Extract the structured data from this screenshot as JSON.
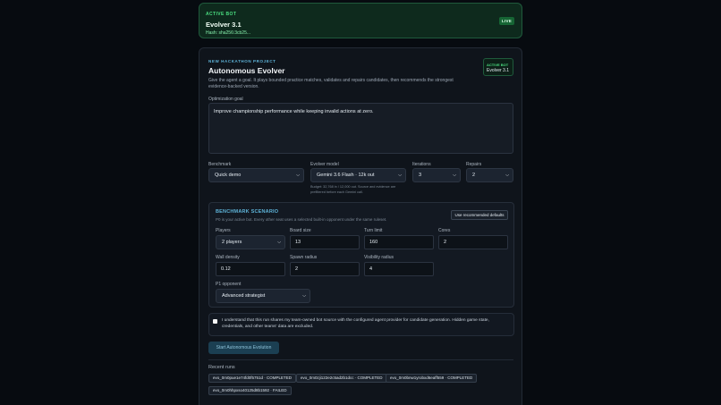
{
  "active_bot": {
    "label": "ACTIVE BOT",
    "name": "Evolver 3.1",
    "hash": "Hash: sha256:3cb25...",
    "status": "LIVE"
  },
  "project": {
    "eyebrow": "NEW HACKATHON PROJECT",
    "title": "Autonomous Evolver",
    "description": "Give the agent a goal. It plays bounded practice matches, validates and repairs candidates, then recommends the strongest evidence-backed version.",
    "badge_label": "ACTIVE BOT",
    "badge_value": "Evolver 3.1"
  },
  "goal": {
    "label": "Optimization goal",
    "value": "Improve championship performance while keeping invalid actions at zero."
  },
  "config": {
    "benchmark_label": "Benchmark",
    "benchmark_value": "Quick demo",
    "model_label": "Evolver model",
    "model_value": "Gemini 3.6 Flash · 12k out",
    "model_hint": "Budget: 32,768 in / 12,000 out. Source and evidence are prefiltered before each Gemini call.",
    "iterations_label": "Iterations",
    "iterations_value": "3",
    "repairs_label": "Repairs",
    "repairs_value": "2"
  },
  "scenario": {
    "title": "BENCHMARK SCENARIO",
    "subtitle": "P0 is your active bot. Every other seat uses a selected built-in opponent under the same ruleset.",
    "recommended_button": "Use recommended defaults",
    "players_label": "Players",
    "players_value": "2 players",
    "board_size_label": "Board size",
    "board_size_value": "13",
    "turn_limit_label": "Turn limit",
    "turn_limit_value": "160",
    "cores_label": "Cores",
    "cores_value": "2",
    "wall_density_label": "Wall density",
    "wall_density_value": "0.12",
    "spawn_radius_label": "Spawn radius",
    "spawn_radius_value": "2",
    "visibility_radius_label": "Visibility radius",
    "visibility_radius_value": "4",
    "opponent_label": "P1 opponent",
    "opponent_value": "Advanced strategist"
  },
  "consent": {
    "text": "I understand that this run shares my team-owned bot source with the configured agent provider for candidate generation. Hidden game state, credentials, and other teams' data are excluded.",
    "checked": false
  },
  "start_button": "Start Autonomous Evolution",
  "recent_runs": {
    "title": "Recent runs",
    "items": [
      "evo_0m0pue1e74fd0f5751d · COMPLETED",
      "evo_0m0zji122e2c5ad2b1dcc · COMPLETED",
      "evo_0m0bnw1yrobxd6eaff559 · COMPLETED",
      "evo_0m0hhpxso40125d8b1592 · FAILED"
    ]
  },
  "colors": {
    "accent": "#5eb3d8",
    "live_green": "#4ade80",
    "background": "#070b10"
  }
}
